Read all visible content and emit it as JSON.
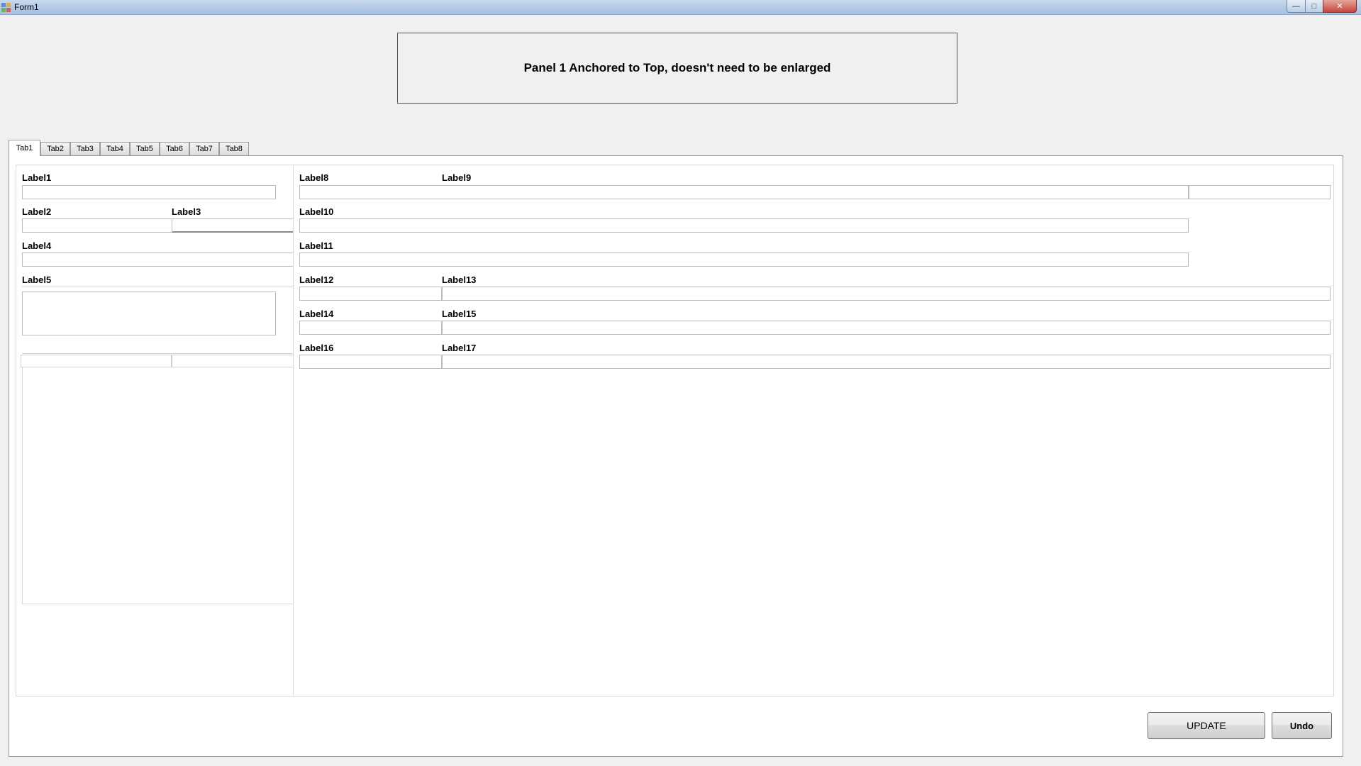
{
  "window": {
    "title": "Form1",
    "minimize_glyph": "—",
    "maximize_glyph": "□",
    "close_glyph": "✕"
  },
  "panel1": {
    "text": "Panel 1 Anchored to Top, doesn't need to be enlarged"
  },
  "tabs": [
    {
      "label": "Tab1",
      "selected": true
    },
    {
      "label": "Tab2"
    },
    {
      "label": "Tab3"
    },
    {
      "label": "Tab4"
    },
    {
      "label": "Tab5"
    },
    {
      "label": "Tab6"
    },
    {
      "label": "Tab7"
    },
    {
      "label": "Tab8"
    }
  ],
  "labels": {
    "label1": "Label1",
    "label2": "Label2",
    "label3": "Label3",
    "label4": "Label4",
    "label5": "Label5",
    "label8": "Label8",
    "label9": "Label9",
    "label10": "Label10",
    "label11": "Label11",
    "label12": "Label12",
    "label13": "Label13",
    "label14": "Label14",
    "label15": "Label15",
    "label16": "Label16",
    "label17": "Label17"
  },
  "fields": {
    "textbox1": "",
    "textbox2": "",
    "textbox3": "",
    "textbox4": "",
    "textbox5": "",
    "textbox8": "",
    "textbox9": "",
    "textbox10": "",
    "textbox11": "",
    "textbox12": "",
    "textbox13": "",
    "textbox14": "",
    "textbox15": "",
    "textbox16": "",
    "textbox17": ""
  },
  "buttons": {
    "update": "UPDATE",
    "undo": "Undo"
  }
}
